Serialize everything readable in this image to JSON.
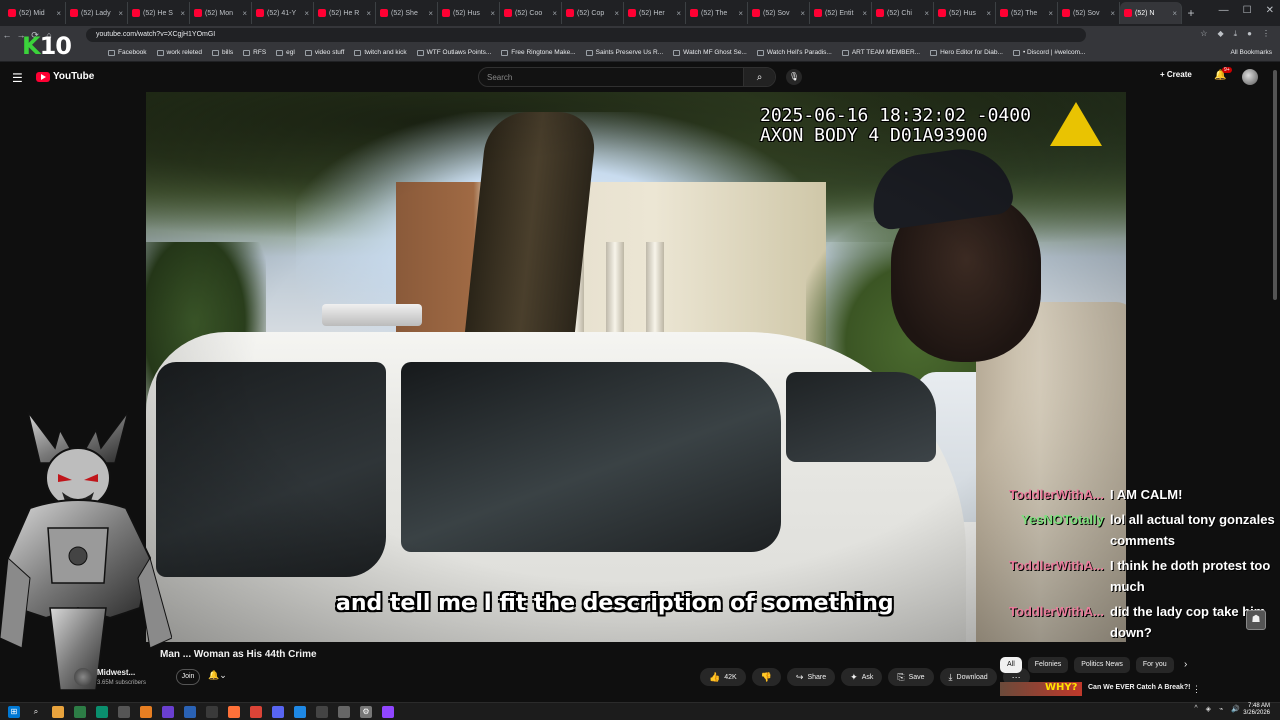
{
  "browser": {
    "tabs": [
      {
        "label": "(52) Mid"
      },
      {
        "label": "(52) Lady"
      },
      {
        "label": "(52) He S"
      },
      {
        "label": "(52) Mon"
      },
      {
        "label": "(52) 41-Y"
      },
      {
        "label": "(52) He R"
      },
      {
        "label": "(52) She"
      },
      {
        "label": "(52) Hus"
      },
      {
        "label": "(52) Coo"
      },
      {
        "label": "(52) Cop"
      },
      {
        "label": "(52) Her"
      },
      {
        "label": "(52) The"
      },
      {
        "label": "(52) Sov"
      },
      {
        "label": "(52) Entit"
      },
      {
        "label": "(52) Chi"
      },
      {
        "label": "(52) Hus"
      },
      {
        "label": "(52) The"
      },
      {
        "label": "(52) Sov"
      },
      {
        "label": "(52) N"
      }
    ],
    "url": "youtube.com/watch?v=XCgjH1YOmGI",
    "bookmarks": [
      "Facebook",
      "work releted",
      "bills",
      "RFS",
      "egl",
      "video stuff",
      "twitch and kick",
      "WTF Outlaws Points...",
      "Free Ringtone Make...",
      "Saints Preserve Us R...",
      "Watch MF Ghost Se...",
      "Watch Hell's Paradis...",
      "ART TEAM MEMBER...",
      "Hero Editor for Diab...",
      "• Discord | #welcom..."
    ],
    "all_bookmarks_label": "All Bookmarks"
  },
  "overlay": {
    "logo_k": "K",
    "logo_num": "10"
  },
  "youtube": {
    "logo_label": "YouTube",
    "search_placeholder": "Search",
    "create_label": "Create",
    "notification_count": "9+"
  },
  "video": {
    "timestamp": "2025-06-16 18:32:02 -0400\nAXON BODY 4 D01A93900",
    "subtitle": "and tell me I fit the description of something",
    "title": "Man ... Woman as His 44th Crime",
    "channel": "Midwest...",
    "subscribers": "3.65M subscribers",
    "join_label": "Join",
    "likes": "42K",
    "share_label": "Share",
    "ask_label": "Ask",
    "save_label": "Save",
    "download_label": "Download"
  },
  "chat": [
    {
      "user": "ToddlerWithA...",
      "color": "#e87b9a",
      "message": "I AM CALM!"
    },
    {
      "user": "YesNOTotally",
      "color": "#7de07d",
      "message": "lol all actual tony gonzales comments"
    },
    {
      "user": "ToddlerWithA...",
      "color": "#e87b9a",
      "message": "I think he doth protest too much"
    },
    {
      "user": "ToddlerWithA...",
      "color": "#e87b9a",
      "message": "did the lady cop take him down?"
    }
  ],
  "recommendations": {
    "chips": [
      "All",
      "Felonies",
      "Politics News",
      "For you"
    ],
    "first_title": "Can We EVER Catch A Break?!",
    "first_thumb_text": "WHY?"
  },
  "taskbar": {
    "time": "7:48 AM",
    "date": "3/26/2026"
  },
  "colors": {
    "youtube_red": "#ff0033",
    "background": "#0f0f0f",
    "chat_user_pink": "#e87b9a",
    "chat_user_green": "#7de07d"
  }
}
